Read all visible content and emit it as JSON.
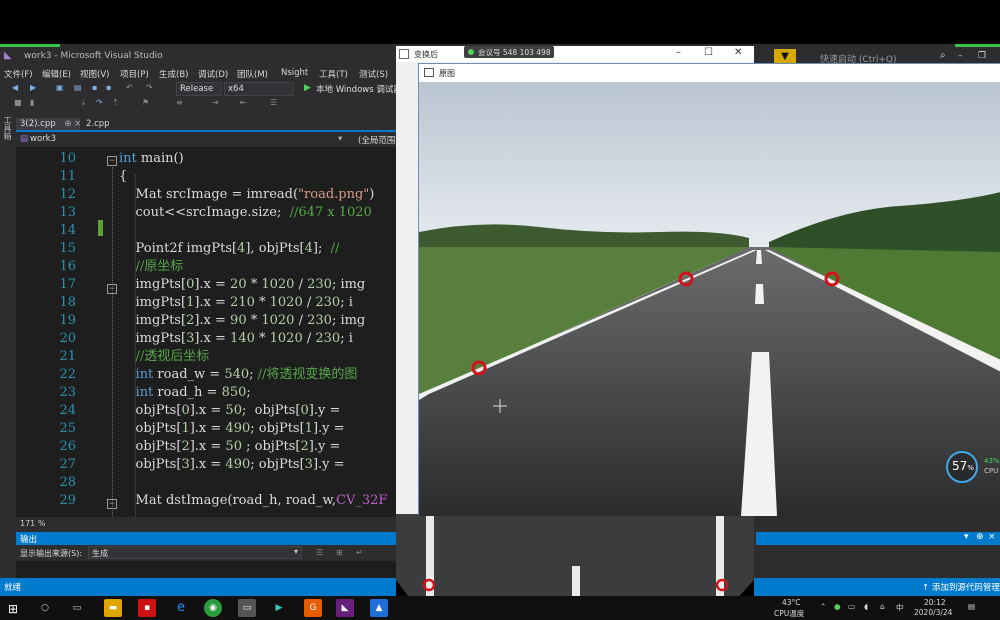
{
  "vs": {
    "title": "work3 - Microsoft Visual Studio",
    "quick_launch_placeholder": "快速启动 (Ctrl+Q)",
    "menu": [
      "文件(F)",
      "编辑(E)",
      "视图(V)",
      "项目(P)",
      "生成(B)",
      "调试(D)",
      "团队(M)",
      "Nsight",
      "工具(T)",
      "测试(S)"
    ],
    "toolbar": {
      "configuration": "Release",
      "platform": "x64",
      "debugger": "本地 Windows 调试器"
    },
    "left_tab_label": "工具箱",
    "file_tabs": [
      {
        "label": "3(2).cpp",
        "active": true
      },
      {
        "label": "2.cpp",
        "active": false
      }
    ],
    "nav_project": "work3",
    "nav_scope": "(全局范围)",
    "zoom": "171 %",
    "output": {
      "header": "输出",
      "show_from_label": "显示输出来源(S):",
      "source": "生成"
    },
    "status_left": "就绪",
    "status_right": "添加到源代码管理"
  },
  "code_lines": [
    {
      "n": "10",
      "html": "<span class=\"kw\">int</span> main()"
    },
    {
      "n": "11",
      "html": "{"
    },
    {
      "n": "12",
      "html": "    Mat srcImage = imread(<span class=\"str\">\"road.png\"</span>)"
    },
    {
      "n": "13",
      "html": "    cout&lt;&lt;srcImage.size;  <span class=\"cmt\">//647 x 1020</span>"
    },
    {
      "n": "14",
      "html": ""
    },
    {
      "n": "15",
      "html": "    Point2f imgPts[<span class=\"num\">4</span>], objPts[<span class=\"num\">4</span>];  <span class=\"cmt\">//</span>"
    },
    {
      "n": "16",
      "html": "    <span class=\"cmt\">//原坐标</span>"
    },
    {
      "n": "17",
      "html": "    imgPts[<span class=\"num\">0</span>].x = <span class=\"num\">20</span> * <span class=\"num\">1020</span> / <span class=\"num\">230</span>; img"
    },
    {
      "n": "18",
      "html": "    imgPts[<span class=\"num\">1</span>].x = <span class=\"num\">210</span> * <span class=\"num\">1020</span> / <span class=\"num\">230</span>; i"
    },
    {
      "n": "19",
      "html": "    imgPts[<span class=\"num\">2</span>].x = <span class=\"num\">90</span> * <span class=\"num\">1020</span> / <span class=\"num\">230</span>; img"
    },
    {
      "n": "20",
      "html": "    imgPts[<span class=\"num\">3</span>].x = <span class=\"num\">140</span> * <span class=\"num\">1020</span> / <span class=\"num\">230</span>; i"
    },
    {
      "n": "21",
      "html": "    <span class=\"cmt\">//透视后坐标</span>"
    },
    {
      "n": "22",
      "html": "    <span class=\"kw\">int</span> road_w = <span class=\"num\">540</span>; <span class=\"cmt\">//将透视变换的图</span>"
    },
    {
      "n": "23",
      "html": "    <span class=\"kw\">int</span> road_h = <span class=\"num\">850</span>;"
    },
    {
      "n": "24",
      "html": "    objPts[<span class=\"num\">0</span>].x = <span class=\"num\">50</span>;  objPts[<span class=\"num\">0</span>].y = "
    },
    {
      "n": "25",
      "html": "    objPts[<span class=\"num\">1</span>].x = <span class=\"num\">490</span>; objPts[<span class=\"num\">1</span>].y = "
    },
    {
      "n": "26",
      "html": "    objPts[<span class=\"num\">2</span>].x = <span class=\"num\">50</span> ; objPts[<span class=\"num\">2</span>].y = "
    },
    {
      "n": "27",
      "html": "    objPts[<span class=\"num\">3</span>].x = <span class=\"num\">490</span>; objPts[<span class=\"num\">3</span>].y = "
    },
    {
      "n": "28",
      "html": ""
    },
    {
      "n": "29",
      "html": "    Mat dstImage(road_h, road_w,<span class=\"pur\">CV_32F</span>"
    }
  ],
  "trans_window": {
    "title": "变换后"
  },
  "meeting_badge": "会议号 548 103 498",
  "orig_window": {
    "title": "原图"
  },
  "cpu": {
    "percent": "57",
    "percent_sign": "%",
    "side_value": "43%",
    "side_label": "CPU"
  },
  "taskbar": {
    "temp": "43°C",
    "temp_label": "CPU温度",
    "time": "20:12",
    "date": "2020/3/24",
    "lang": "中"
  }
}
